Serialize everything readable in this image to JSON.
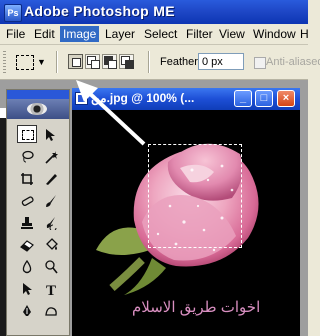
{
  "app": {
    "title": "Adobe Photoshop ME",
    "icon": "photoshop-icon"
  },
  "menu": [
    {
      "label": "File"
    },
    {
      "label": "Edit"
    },
    {
      "label": "Image",
      "active": true
    },
    {
      "label": "Layer"
    },
    {
      "label": "Select"
    },
    {
      "label": "Filter"
    },
    {
      "label": "View"
    },
    {
      "label": "Window"
    },
    {
      "label": "H"
    }
  ],
  "options": {
    "feather_label": "Feather:",
    "feather_value": "0 px",
    "anti_alias_label": "Anti-aliased"
  },
  "document": {
    "title": "من.jpg @ 100% (...",
    "minimize": "_",
    "maximize": "□",
    "close": "×",
    "watermark": "اخوات طريق الاسلام"
  },
  "colors": {
    "accent_menu": "#316ac5",
    "titlebar": "#2a5bdc",
    "close_button": "#d44514"
  }
}
